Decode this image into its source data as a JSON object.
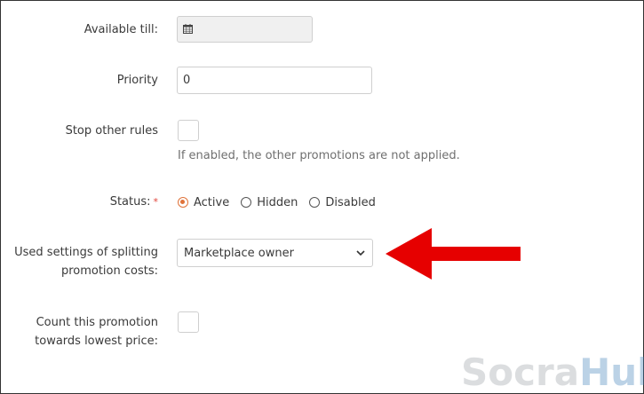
{
  "form": {
    "available_till": {
      "label": "Available till:",
      "value": ""
    },
    "priority": {
      "label": "Priority",
      "value": "0"
    },
    "stop_other_rules": {
      "label": "Stop other rules",
      "checked": false,
      "help": "If enabled, the other promotions are not applied."
    },
    "status": {
      "label": "Status:",
      "required_mark": "*",
      "options": [
        "Active",
        "Hidden",
        "Disabled"
      ],
      "selected": "Active"
    },
    "splitting": {
      "label_line1": "Used settings of splitting",
      "label_line2": "promotion costs:",
      "selected": "Marketplace owner"
    },
    "lowest_price": {
      "label_line1": "Count this promotion",
      "label_line2": "towards lowest price:",
      "checked": false
    }
  },
  "annotation": {
    "arrow_color": "#e60000"
  },
  "watermark": {
    "part1": "Socra",
    "part2": "Hub"
  },
  "colors": {
    "accent": "#e0733a",
    "required": "#e0443b"
  },
  "icons": [
    "calendar-icon",
    "chevron-down-icon",
    "red-arrow-annotation"
  ]
}
